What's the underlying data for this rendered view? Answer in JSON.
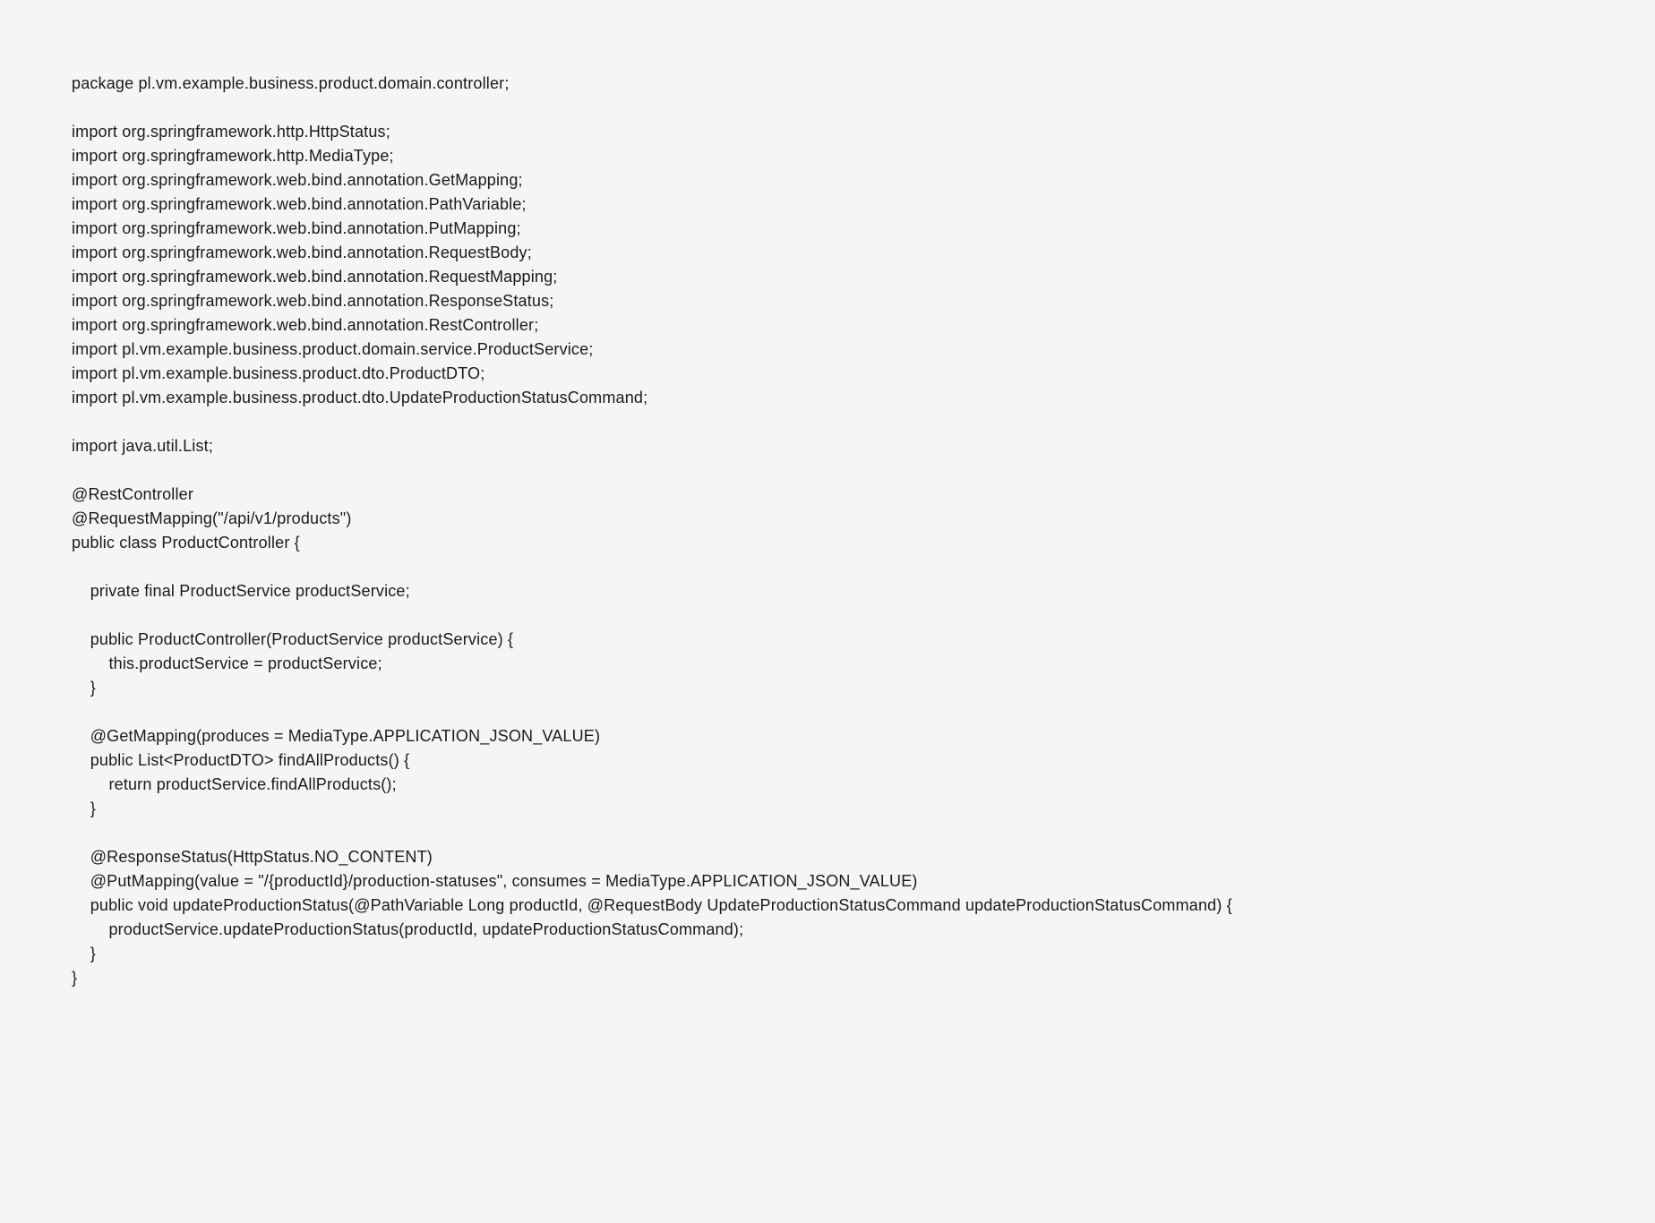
{
  "code": "package pl.vm.example.business.product.domain.controller;\n\nimport org.springframework.http.HttpStatus;\nimport org.springframework.http.MediaType;\nimport org.springframework.web.bind.annotation.GetMapping;\nimport org.springframework.web.bind.annotation.PathVariable;\nimport org.springframework.web.bind.annotation.PutMapping;\nimport org.springframework.web.bind.annotation.RequestBody;\nimport org.springframework.web.bind.annotation.RequestMapping;\nimport org.springframework.web.bind.annotation.ResponseStatus;\nimport org.springframework.web.bind.annotation.RestController;\nimport pl.vm.example.business.product.domain.service.ProductService;\nimport pl.vm.example.business.product.dto.ProductDTO;\nimport pl.vm.example.business.product.dto.UpdateProductionStatusCommand;\n\nimport java.util.List;\n\n@RestController\n@RequestMapping(\"/api/v1/products\")\npublic class ProductController {\n\n    private final ProductService productService;\n\n    public ProductController(ProductService productService) {\n        this.productService = productService;\n    }\n\n    @GetMapping(produces = MediaType.APPLICATION_JSON_VALUE)\n    public List<ProductDTO> findAllProducts() {\n        return productService.findAllProducts();\n    }\n\n    @ResponseStatus(HttpStatus.NO_CONTENT)\n    @PutMapping(value = \"/{productId}/production-statuses\", consumes = MediaType.APPLICATION_JSON_VALUE)\n    public void updateProductionStatus(@PathVariable Long productId, @RequestBody UpdateProductionStatusCommand updateProductionStatusCommand) {\n        productService.updateProductionStatus(productId, updateProductionStatusCommand);\n    }\n}"
}
